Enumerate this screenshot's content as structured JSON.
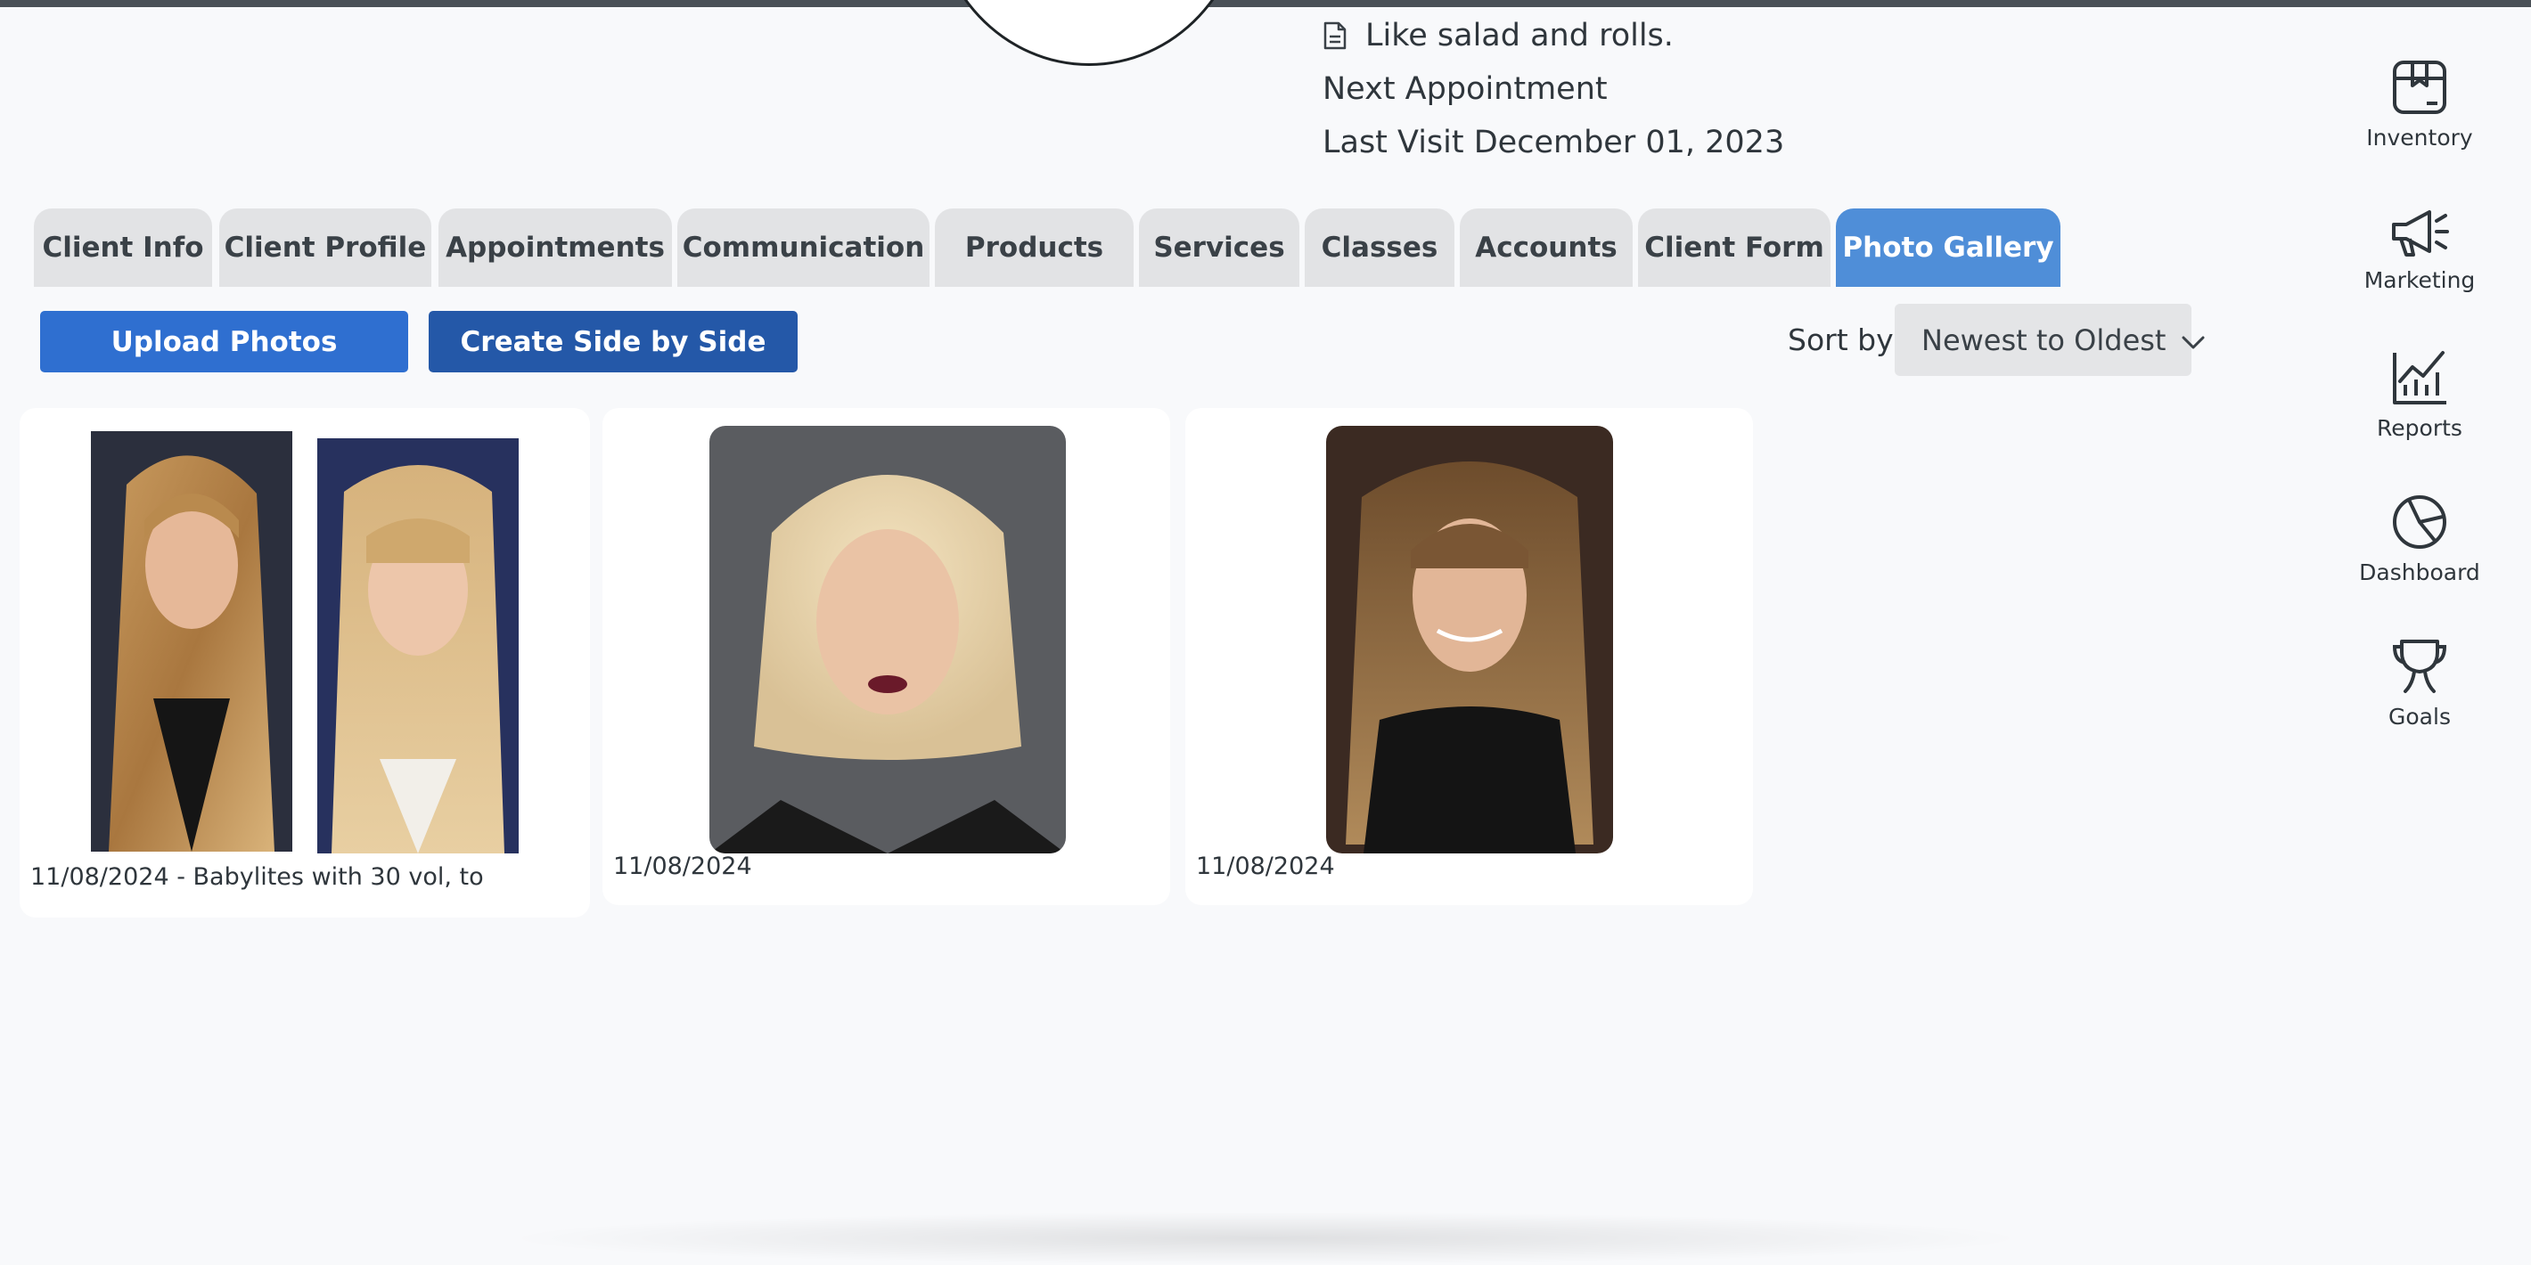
{
  "header": {
    "note": "Like salad and rolls.",
    "next_appointment": "Next Appointment",
    "last_visit": "Last Visit December 01, 2023"
  },
  "tabs": [
    {
      "label": "Client Info"
    },
    {
      "label": "Client Profile"
    },
    {
      "label": "Appointments"
    },
    {
      "label": "Communication"
    },
    {
      "label": "Products"
    },
    {
      "label": "Services"
    },
    {
      "label": "Classes"
    },
    {
      "label": "Accounts"
    },
    {
      "label": "Client Form"
    },
    {
      "label": "Photo Gallery",
      "active": true
    }
  ],
  "actions": {
    "upload_label": "Upload Photos",
    "side_by_side_label": "Create Side by Side"
  },
  "sort": {
    "label": "Sort by",
    "selected": "Newest to Oldest"
  },
  "gallery": [
    {
      "caption": "11/08/2024 - Babylites with 30 vol, to"
    },
    {
      "caption": "11/08/2024"
    },
    {
      "caption": "11/08/2024"
    }
  ],
  "sidebar": {
    "items": [
      {
        "label": "Inventory",
        "icon": "inventory-box-icon"
      },
      {
        "label": "Marketing",
        "icon": "megaphone-icon"
      },
      {
        "label": "Reports",
        "icon": "chart-line-icon"
      },
      {
        "label": "Dashboard",
        "icon": "pie-chart-icon"
      },
      {
        "label": "Goals",
        "icon": "trophy-icon"
      }
    ]
  },
  "colors": {
    "active_tab": "#4f8ed8",
    "upload_button": "#2f6fd0",
    "side_by_side_button": "#2458a8",
    "tab_background": "#e2e3e5"
  }
}
